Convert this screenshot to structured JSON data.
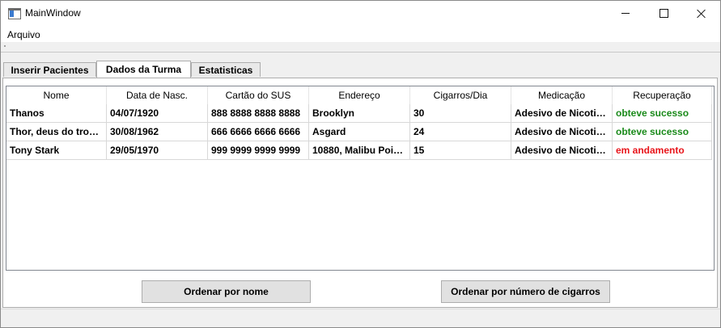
{
  "window": {
    "title": "MainWindow"
  },
  "menu": {
    "items": [
      "Arquivo"
    ]
  },
  "tabs": [
    "Inserir Pacientes",
    "Dados da Turma",
    "Estatisticas"
  ],
  "table": {
    "columns": [
      "Nome",
      "Data de Nasc.",
      "Cartão do SUS",
      "Endereço",
      "Cigarros/Dia",
      "Medicação",
      "Recuperação"
    ],
    "rows": [
      [
        "Thanos",
        "04/07/1920",
        "888 8888 8888 8888",
        "Brooklyn",
        "30",
        "Adesivo de Nicoti…",
        "obteve sucesso"
      ],
      [
        "Thor, deus do tro…",
        "30/08/1962",
        "666 6666 6666 6666",
        "Asgard",
        "24",
        "Adesivo de Nicoti…",
        "obteve sucesso"
      ],
      [
        "Tony Stark",
        "29/05/1970",
        "999 9999 9999 9999",
        "10880, Malibu Poi…",
        "15",
        "Adesivo de Nicoti…",
        "em andamento"
      ]
    ],
    "status_colors": {
      "obteve sucesso": "#1a8a1a",
      "em andamento": "#e8141a"
    }
  },
  "buttons": {
    "sort_by_name": "Ordenar por nome",
    "sort_by_cigarettes": "Ordenar por número de cigarros"
  }
}
